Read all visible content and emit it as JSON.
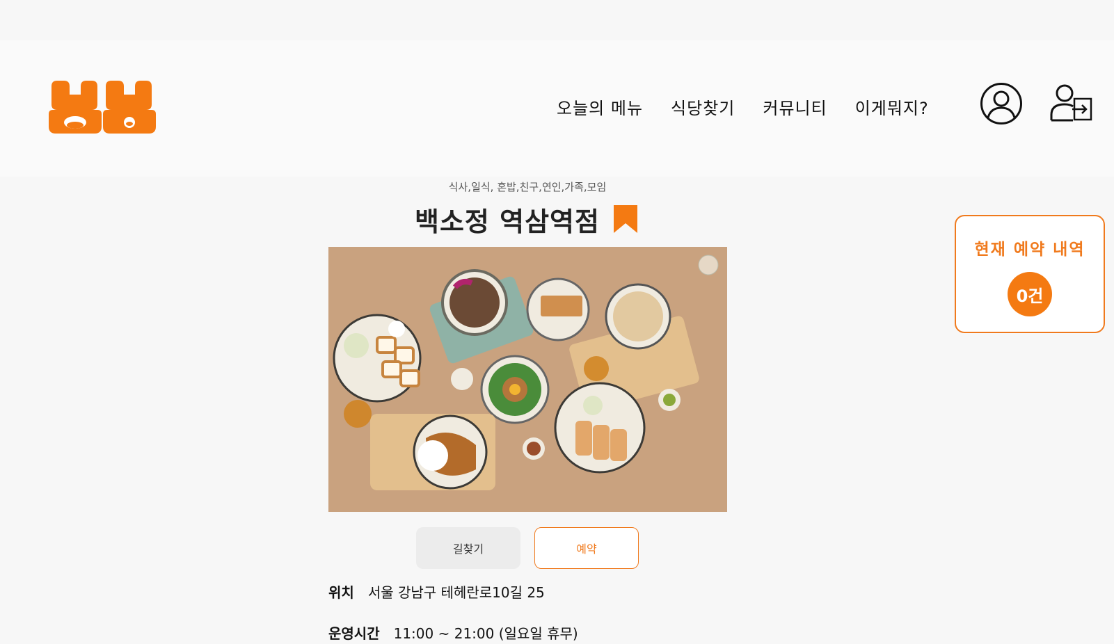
{
  "header": {
    "logo_text": "냠냠",
    "nav": [
      "오늘의 메뉴",
      "식당찾기",
      "커뮤니티",
      "이게뭐지?"
    ],
    "user_icon": "user-circle-icon",
    "login_icon": "user-login-icon"
  },
  "restaurant": {
    "tags": "식사,일식, 혼밥,친구,연인,가족,모임",
    "name": "백소정 역삼역점",
    "bookmark_icon": "bookmark-icon",
    "photo_alt": "food-photo"
  },
  "actions": {
    "directions_label": "길찾기",
    "reserve_label": "예약"
  },
  "info": {
    "location_label": "위치",
    "location_value": "서울 강남구 테헤란로10길 25",
    "hours_label": "운영시간",
    "hours_value": "11:00 ~ 21:00 (일요일 휴무)"
  },
  "reservation_card": {
    "title": "현재 예약 내역",
    "count": "0건"
  },
  "colors": {
    "accent": "#f47a12",
    "background": "#f7f7f7"
  }
}
